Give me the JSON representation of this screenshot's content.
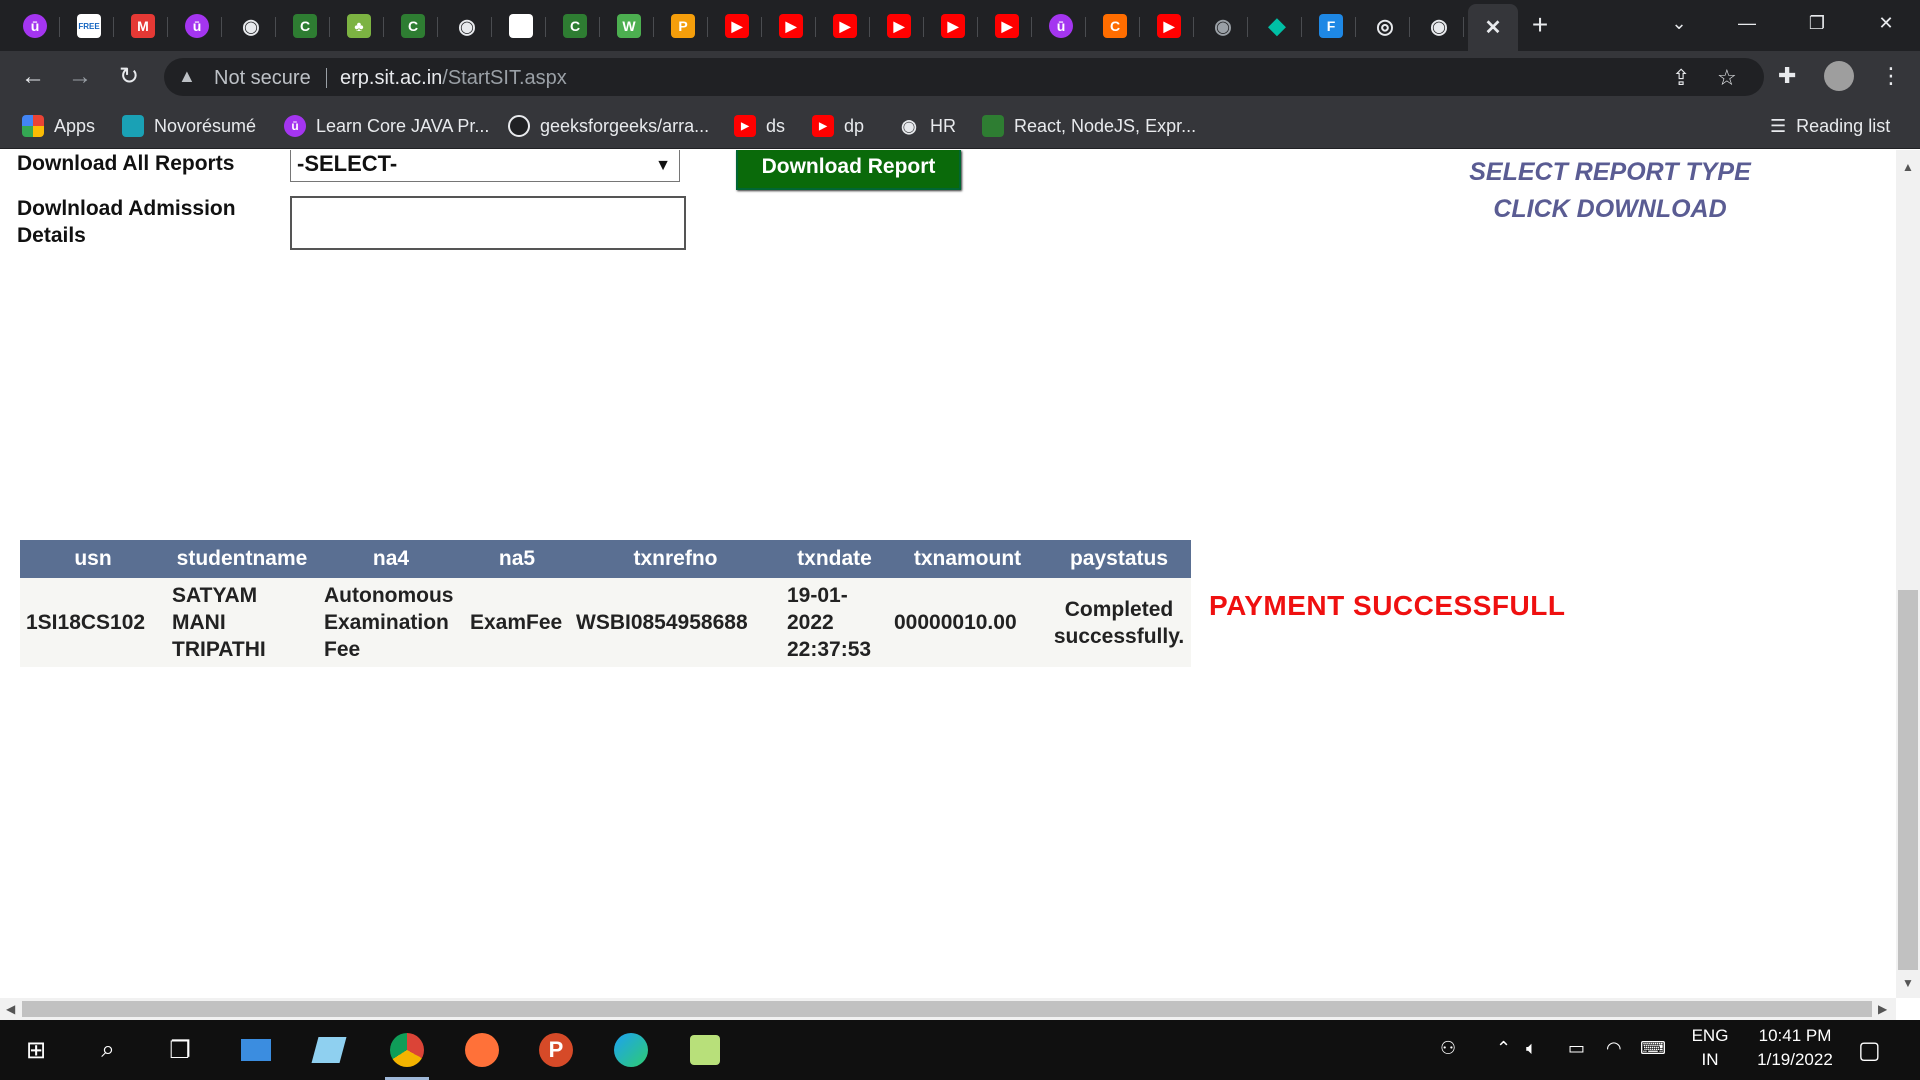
{
  "tabs": [
    {
      "icon": "udemy-icon",
      "glyph": "ū",
      "color": "#a435f0"
    },
    {
      "icon": "free-icon",
      "glyph": "FREE",
      "color": "#ffffff"
    },
    {
      "icon": "m-red-icon",
      "glyph": "M",
      "color": "#e53935"
    },
    {
      "icon": "udemy-icon",
      "glyph": "ū",
      "color": "#a435f0"
    },
    {
      "icon": "globe-icon",
      "glyph": "◉",
      "color": "#e8eaed"
    },
    {
      "icon": "codechef-green-icon",
      "glyph": "C",
      "color": "#2e7d32"
    },
    {
      "icon": "leaf-icon",
      "glyph": "♣",
      "color": "#7cb342"
    },
    {
      "icon": "codechef-green-icon",
      "glyph": "C",
      "color": "#2e7d32"
    },
    {
      "icon": "globe-icon",
      "glyph": "◉",
      "color": "#e8eaed"
    },
    {
      "icon": "google-icon",
      "glyph": "G",
      "color": "#ffffff"
    },
    {
      "icon": "codechef-green-icon",
      "glyph": "C",
      "color": "#2e7d32"
    },
    {
      "icon": "w3-icon",
      "glyph": "W",
      "color": "#4caf50"
    },
    {
      "icon": "p-orange-icon",
      "glyph": "P",
      "color": "#f59e0b"
    },
    {
      "icon": "youtube-icon",
      "glyph": "▶",
      "color": "#ff0000"
    },
    {
      "icon": "youtube-icon",
      "glyph": "▶",
      "color": "#ff0000"
    },
    {
      "icon": "youtube-icon",
      "glyph": "▶",
      "color": "#ff0000"
    },
    {
      "icon": "youtube-icon",
      "glyph": "▶",
      "color": "#ff0000"
    },
    {
      "icon": "youtube-icon",
      "glyph": "▶",
      "color": "#ff0000"
    },
    {
      "icon": "youtube-icon",
      "glyph": "▶",
      "color": "#ff0000"
    },
    {
      "icon": "udemy-icon",
      "glyph": "ū",
      "color": "#a435f0"
    },
    {
      "icon": "c-orange-icon",
      "glyph": "C",
      "color": "#ff6d00"
    },
    {
      "icon": "youtube-icon",
      "glyph": "▶",
      "color": "#ff0000"
    },
    {
      "icon": "globe-gray-icon",
      "glyph": "◉",
      "color": "#9aa0a6"
    },
    {
      "icon": "diamond-icon",
      "glyph": "◆",
      "color": "#00bfa5"
    },
    {
      "icon": "f-blue-icon",
      "glyph": "F",
      "color": "#1e88e5"
    },
    {
      "icon": "chrome-icon",
      "glyph": "◎",
      "color": "#e8eaed"
    },
    {
      "icon": "globe-icon",
      "glyph": "◉",
      "color": "#e8eaed"
    },
    {
      "icon": "close-icon",
      "glyph": "✕",
      "color": "#e8eaed"
    }
  ],
  "address": {
    "security": "Not secure",
    "host": "erp.sit.ac.in",
    "path": "/StartSIT.aspx"
  },
  "bookmarks": [
    {
      "label": "Apps",
      "icon": "apps-grid-icon",
      "color": "#ea4335"
    },
    {
      "label": "Novorésumé",
      "icon": "novoresume-icon",
      "color": "#1aa1b5"
    },
    {
      "label": "Learn Core JAVA Pr...",
      "icon": "udemy-icon",
      "color": "#a435f0"
    },
    {
      "label": "geeksforgeeks/arra...",
      "icon": "github-icon",
      "color": "#202124"
    },
    {
      "label": "ds",
      "icon": "youtube-icon",
      "color": "#ff0000"
    },
    {
      "label": "dp",
      "icon": "youtube-icon",
      "color": "#ff0000"
    },
    {
      "label": "HR",
      "icon": "globe-icon",
      "color": "#e8eaed"
    },
    {
      "label": "React, NodeJS, Expr...",
      "icon": "codechef-green-icon",
      "color": "#2e7d32"
    }
  ],
  "reading_list": "Reading list",
  "form": {
    "download_all_label": "Download All Reports",
    "select_value": "-SELECT-",
    "admission_label_line1": "Dowlnload Admission",
    "admission_label_line2": "Details",
    "download_button": "Download Report",
    "hint_line1": "SELECT REPORT TYPE",
    "hint_line2": "CLICK DOWNLOAD"
  },
  "table": {
    "headers": [
      "usn",
      "studentname",
      "na4",
      "na5",
      "txnrefno",
      "txndate",
      "txnamount",
      "paystatus"
    ],
    "row": {
      "usn": "1SI18CS102",
      "studentname": [
        "SATYAM",
        "MANI",
        "TRIPATHI"
      ],
      "na4": [
        "Autonomous",
        "Examination",
        "Fee"
      ],
      "na5": "ExamFee",
      "txnrefno": "WSBI0854958688",
      "txndate": [
        "19-01-",
        "2022",
        "22:37:53"
      ],
      "txnamount": "00000010.00",
      "paystatus": [
        "Completed",
        "successfully."
      ]
    }
  },
  "payment_status": "PAYMENT SUCCESSFULL",
  "taskbar": {
    "lang_line1": "ENG",
    "lang_line2": "IN",
    "time": "10:41 PM",
    "date": "1/19/2022"
  }
}
